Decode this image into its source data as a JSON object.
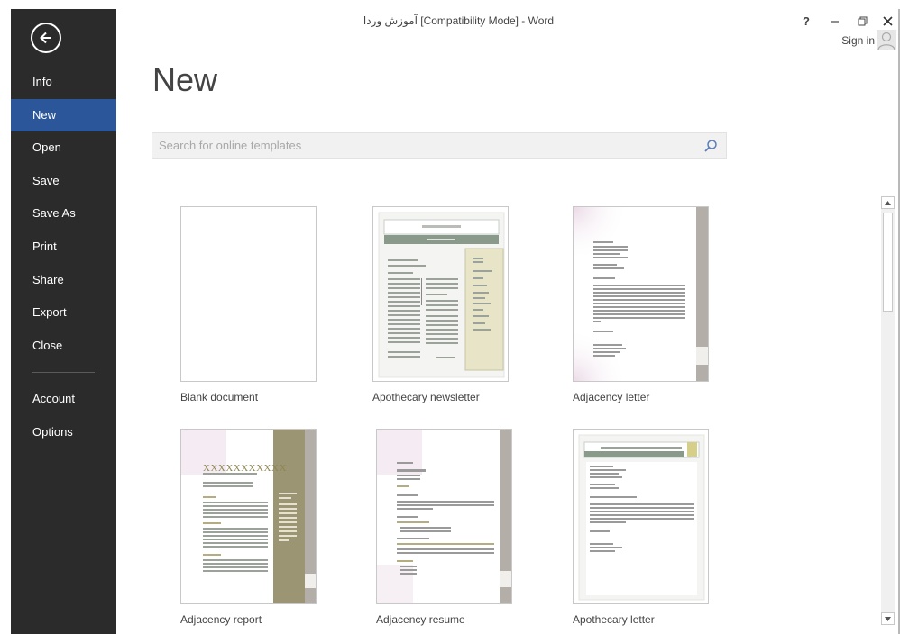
{
  "window": {
    "title": "آموزش وردا [Compatibility Mode] - Word",
    "help_label": "?",
    "sign_in_label": "Sign in"
  },
  "sidebar": {
    "items": [
      {
        "label": "Info",
        "active": false
      },
      {
        "label": "New",
        "active": true
      },
      {
        "label": "Open",
        "active": false
      },
      {
        "label": "Save",
        "active": false
      },
      {
        "label": "Save As",
        "active": false
      },
      {
        "label": "Print",
        "active": false
      },
      {
        "label": "Share",
        "active": false
      },
      {
        "label": "Export",
        "active": false
      },
      {
        "label": "Close",
        "active": false
      }
    ],
    "bottom_items": [
      {
        "label": "Account"
      },
      {
        "label": "Options"
      }
    ]
  },
  "main": {
    "title": "New",
    "search_placeholder": "Search for online templates",
    "templates": [
      {
        "label": "Blank document"
      },
      {
        "label": "Apothecary newsletter"
      },
      {
        "label": "Adjacency letter"
      },
      {
        "label": "Adjacency report",
        "heading_text": "XXXXXXXXXXX"
      },
      {
        "label": "Adjacency resume"
      },
      {
        "label": "Apothecary letter"
      }
    ]
  },
  "colors": {
    "sidebar_bg": "#2b2b2b",
    "active_item": "#2b579a",
    "sage": "#8a9a8a",
    "olive": "#9b9574",
    "taupe": "#b3aea8"
  },
  "icons": {
    "back": "back-arrow-icon",
    "search": "search-icon",
    "help": "help-icon",
    "minimize": "minimize-icon",
    "restore": "restore-icon",
    "close": "close-icon",
    "user": "user-icon"
  }
}
